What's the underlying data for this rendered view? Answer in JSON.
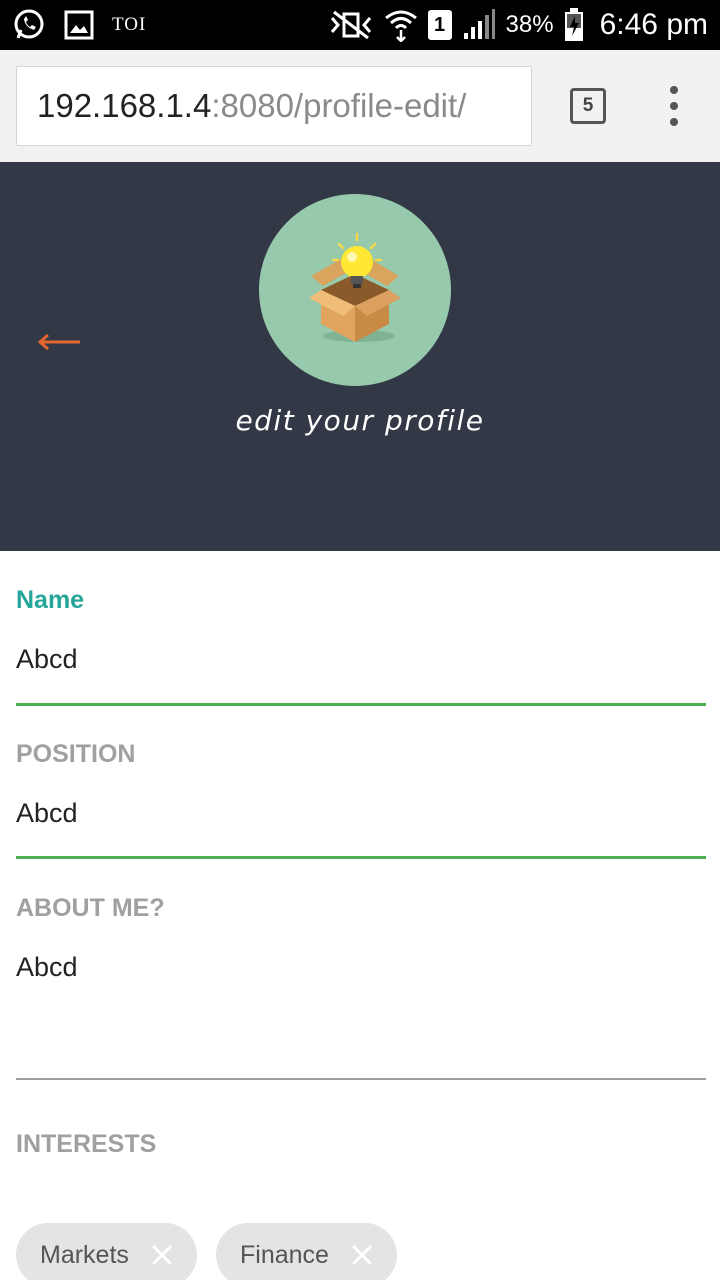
{
  "status_bar": {
    "carrier_label": "TOI",
    "sim_slot": "1",
    "battery": "38%",
    "time": "6:46 pm",
    "icons": [
      "whatsapp-icon",
      "gallery-icon",
      "mute-vibrate-icon",
      "wifi-icon",
      "signal-icon",
      "battery-charging-icon"
    ]
  },
  "browser": {
    "url_host": "192.168.1.4",
    "url_path": ":8080/profile-edit/",
    "tab_count": "5"
  },
  "header": {
    "subtitle": "edit your profile",
    "background_color": "#323846",
    "avatar_color": "#97c9ac",
    "back_arrow_color": "#e2672e"
  },
  "form": {
    "name": {
      "label": "Name",
      "value": "Abcd"
    },
    "position": {
      "label": "POSITION",
      "value": "Abcd"
    },
    "about": {
      "label": "ABOUT ME?",
      "value": "Abcd"
    },
    "interests": {
      "label": "INTERESTS",
      "chips": [
        "Markets",
        "Finance"
      ]
    },
    "accent_color": "#26a69a",
    "underline_color": "#4caf50"
  }
}
